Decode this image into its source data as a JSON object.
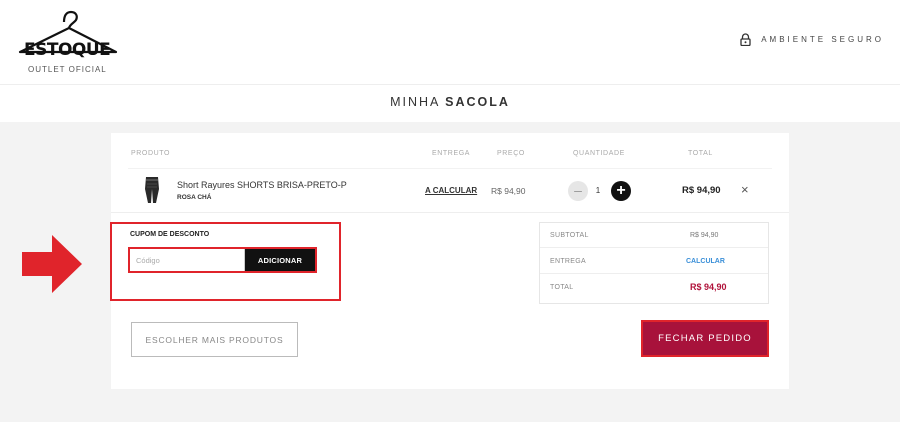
{
  "brand": {
    "name": "ESTOQUE",
    "tagline": "OUTLET OFICIAL"
  },
  "header": {
    "secure_label": "AMBIENTE SEGURO"
  },
  "page": {
    "title_light": "MINHA",
    "title_bold": "SACOLA"
  },
  "table": {
    "headers": [
      "PRODUTO",
      "ENTREGA",
      "PREÇO",
      "QUANTIDADE",
      "TOTAL"
    ]
  },
  "cart_items": [
    {
      "name": "Short Rayures SHORTS BRISA-PRETO-P",
      "brand": "ROSA CHÁ",
      "delivery": "A CALCULAR",
      "price": "R$ 94,90",
      "quantity": "1",
      "total": "R$ 94,90",
      "remove_icon": "×"
    }
  ],
  "coupon": {
    "title": "CUPOM DE DESCONTO",
    "placeholder": "Código",
    "button_label": "ADICIONAR"
  },
  "summary": {
    "subtotal_label": "SUBTOTAL",
    "subtotal_value": "R$ 94,90",
    "delivery_label": "ENTREGA",
    "delivery_value": "CALCULAR",
    "total_label": "TOTAL",
    "total_value": "R$ 94,90"
  },
  "actions": {
    "continue_shopping": "ESCOLHER MAIS PRODUTOS",
    "checkout": "FECHAR PEDIDO"
  },
  "colors": {
    "highlight": "#e0242b",
    "checkout_bg": "#a8123b",
    "total_text": "#b0123a",
    "link": "#3a8fd8"
  },
  "icons": {
    "logo": "hanger-icon",
    "secure": "lock-icon",
    "pointer": "red-arrow-icon"
  }
}
